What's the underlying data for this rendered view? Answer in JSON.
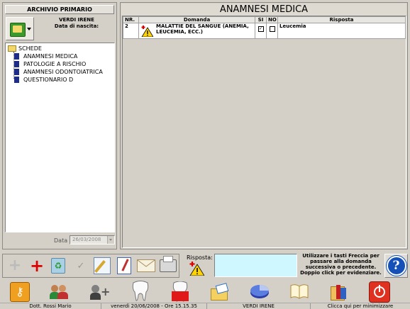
{
  "left": {
    "header": "ARCHIVIO PRIMARIO",
    "patient_name": "VERDI IRENE",
    "birth_label": "Data di nascita:",
    "tree_root": "SCHEDE",
    "tree_items": [
      {
        "label": "ANAMNESI MEDICA"
      },
      {
        "label": "PATOLOGIE A RISCHIO"
      },
      {
        "label": "ANAMNESI ODONTOIATRICA"
      },
      {
        "label": "QUESTIONARIO D"
      }
    ],
    "date_label": "Data",
    "date_value": "26/03/2008"
  },
  "main": {
    "title": "ANAMNESI MEDICA",
    "columns": {
      "nr": "NR.",
      "domanda": "Domanda",
      "si": "SI",
      "no": "NO",
      "risposta": "Risposta"
    },
    "rows": [
      {
        "nr": "2",
        "domanda": "MALATTIE DEL SANGUE (ANEMIA, LEUCEMIA, ECC.)",
        "si": true,
        "no": false,
        "risposta": "Leucemia"
      }
    ]
  },
  "answer": {
    "label": "Risposta:",
    "hint": "Utilizzare i tasti Freccia per passare alla domanda successiva o precedente. Doppio click per evidenziare."
  },
  "toolbar_icons": [
    "add-icon",
    "add-red-icon",
    "recycle-icon",
    "check-icon",
    "edit-pen-icon",
    "notepad-icon",
    "envelope-icon",
    "printer-icon"
  ],
  "bottom_icons": [
    "key-icon",
    "users-icon",
    "add-user-icon",
    "tooth-icon",
    "tooth-red-icon",
    "folder-envelope-icon",
    "pie-chart-icon",
    "book-icon",
    "stack-icon",
    "power-icon"
  ],
  "status": {
    "doctor": "Dott. Rossi Mario",
    "datetime": "venerdì 20/06/2008 - Ore 15.15.35",
    "patient": "VERDI IRENE",
    "minimize": "Clicca qui per minimizzare"
  },
  "colors": {
    "answer_box": "#cff7ff",
    "title_bg": "#dedad2"
  }
}
